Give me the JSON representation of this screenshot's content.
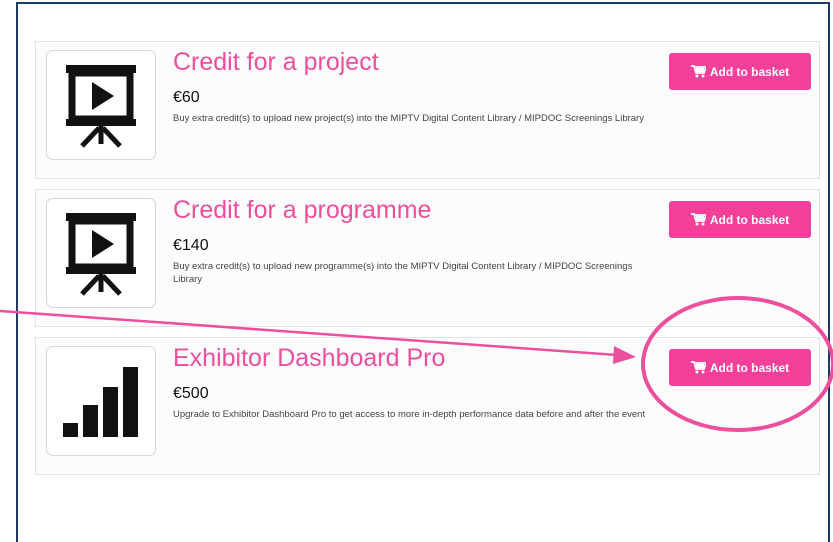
{
  "products": [
    {
      "icon": "presentation-play-icon",
      "title": "Credit for a project",
      "price": "€60",
      "description": "Buy extra credit(s) to upload new project(s) into the MIPTV Digital Content Library / MIPDOC Screenings Library",
      "button_label": "Add to basket"
    },
    {
      "icon": "presentation-play-icon",
      "title": "Credit for a programme",
      "price": "€140",
      "description": "Buy extra credit(s) to upload new programme(s) into the MIPTV Digital Content Library / MIPDOC Screenings Library",
      "button_label": "Add to basket"
    },
    {
      "icon": "signal-bars-icon",
      "title": "Exhibitor Dashboard Pro",
      "price": "€500",
      "description": "Upgrade to Exhibitor Dashboard Pro to get access to more in-depth performance data before and after the event",
      "button_label": "Add to basket"
    }
  ],
  "colors": {
    "accent": "#ec4f9c",
    "button": "#f43f9b",
    "annotation": "#ec4f9c",
    "frame_border": "#1f3a63"
  }
}
